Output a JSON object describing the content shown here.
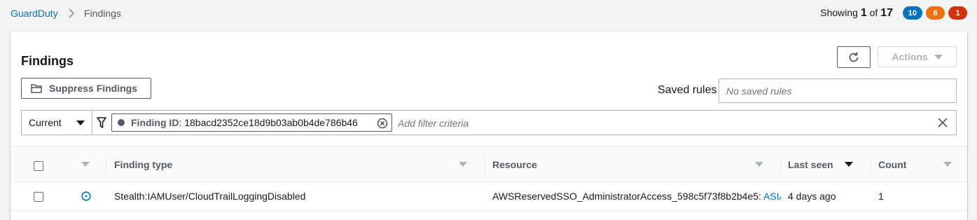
{
  "breadcrumb": {
    "root": "GuardDuty",
    "current": "Findings"
  },
  "summary": {
    "showing_label": "Showing",
    "current": "1",
    "of_label": "of",
    "total": "17"
  },
  "severity_badges": [
    {
      "count": "10",
      "color": "#0073bb"
    },
    {
      "count": "6",
      "color": "#ec7211"
    },
    {
      "count": "1",
      "color": "#d13212"
    }
  ],
  "panel": {
    "title": "Findings",
    "actions_label": "Actions",
    "suppress_label": "Suppress Findings",
    "saved_rules_label": "Saved rules",
    "saved_rules_placeholder": "No saved rules"
  },
  "filter": {
    "scope": "Current",
    "token_key": "Finding ID",
    "token_value": "18bacd2352ce18d9b03ab0b4de786b46",
    "placeholder": "Add filter criteria"
  },
  "table": {
    "columns": [
      "Finding type",
      "Resource",
      "Last seen",
      "Count"
    ],
    "rows": [
      {
        "finding_type": "Stealth:IAMUser/CloudTrailLoggingDisabled",
        "resource_name": "AWSReservedSSO_AdministratorAccess_598c5f73f8b2b4e5:",
        "resource_link": "ASIA",
        "last_seen": "4 days ago",
        "count": "1",
        "severity": "low"
      }
    ]
  },
  "colors": {
    "link": "#0073bb",
    "low_severity": "#0073bb",
    "border": "#aab7b8"
  }
}
